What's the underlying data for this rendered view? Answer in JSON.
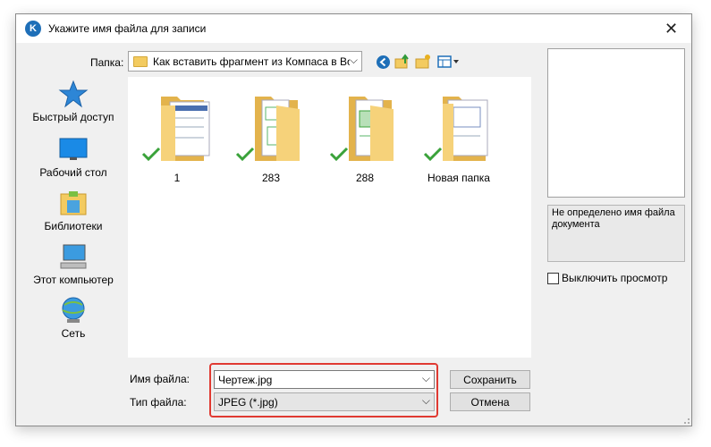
{
  "window": {
    "title": "Укажите имя файла для записи",
    "close_glyph": "✕",
    "title_icon_glyph": "K"
  },
  "toolbar": {
    "folder_label": "Папка:",
    "folder_value": "Как вставить фрагмент из Компаса в Вор",
    "icons": [
      "back-icon",
      "up-folder-icon",
      "new-folder-icon",
      "view-menu-icon"
    ]
  },
  "sidebar": {
    "items": [
      {
        "label": "Быстрый доступ",
        "icon": "star-icon"
      },
      {
        "label": "Рабочий стол",
        "icon": "desktop-icon"
      },
      {
        "label": "Библиотеки",
        "icon": "libraries-icon"
      },
      {
        "label": "Этот компьютер",
        "icon": "computer-icon"
      },
      {
        "label": "Сеть",
        "icon": "network-icon"
      }
    ]
  },
  "files": [
    {
      "name": "1",
      "synced": true
    },
    {
      "name": "283",
      "synced": true
    },
    {
      "name": "288",
      "synced": true
    },
    {
      "name": "Новая папка",
      "synced": true
    }
  ],
  "preview": {
    "message": "Не определено имя файла документа",
    "disable_label": "Выключить просмотр",
    "disable_checked": false
  },
  "form": {
    "filename_label": "Имя файла:",
    "filename_value": "Чертеж.jpg",
    "filetype_label": "Тип файла:",
    "filetype_value": "JPEG (*.jpg)",
    "save_label": "Сохранить",
    "cancel_label": "Отмена"
  },
  "colors": {
    "highlight": "#e03a32",
    "folder": "#f3cb60",
    "check": "#3aa23a",
    "accent": "#1e6fb8"
  }
}
